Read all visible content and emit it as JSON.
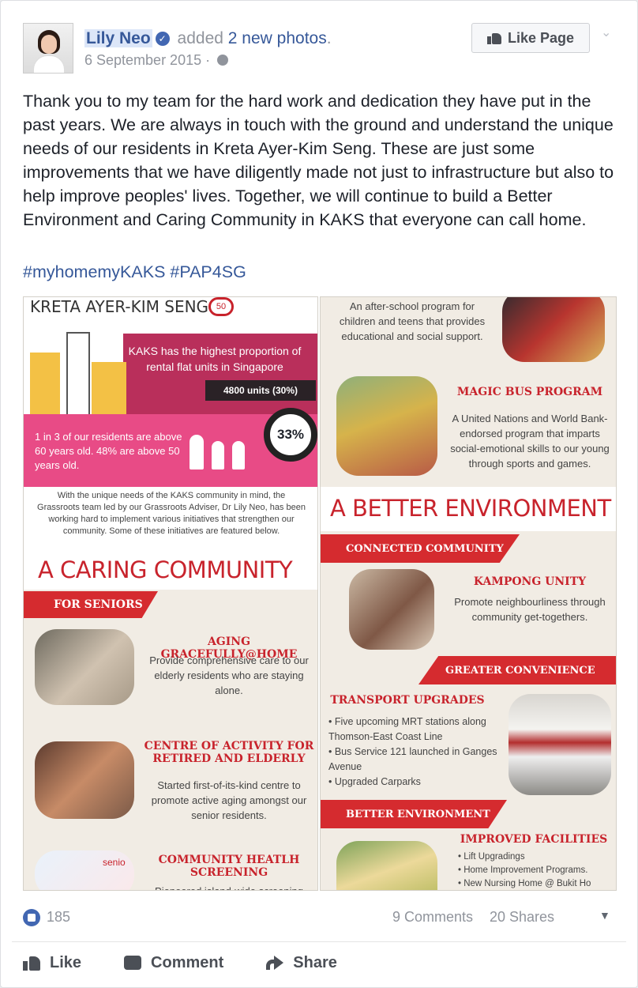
{
  "post": {
    "author": "Lily Neo",
    "action_prefix": "added",
    "action_link": "2 new photos",
    "action_suffix": ".",
    "date": "6 September 2015",
    "like_page_label": "Like Page",
    "body": "Thank you to my team for the hard work and dedication they have put in the past years. We are always in touch with the ground and understand the unique needs of our residents in Kreta Ayer-Kim Seng. These are just some improvements that we have diligently made not just to infrastructure but also to help improve peoples' lives. Together, we will continue to build a Better Environment and Caring Community in KAKS that everyone can call home.",
    "hashtags": "#myhomemyKAKS #PAP4SG"
  },
  "left_infographic": {
    "title": "KRETA AYER-KIM SENG",
    "badge": "50",
    "rental_text": "KAKS has the highest proportion of rental flat units in Singapore",
    "units": "4800 units (30%)",
    "residents_text": "1 in 3 of our residents are above 60 years old. 48% are above 50 years old.",
    "percent": "33%",
    "intro": "With the unique needs of the KAKS community in mind, the Grassroots team led by our Grassroots Adviser, Dr Lily Neo, has been working hard to implement various initiatives that strengthen our community. Some of these initiatives are featured below.",
    "heading": "A CARING COMMUNITY",
    "ribbon": "FOR SENIORS",
    "item1_title": "AGING GRACEFULLY@HOME",
    "item1_text": "Provide comprehensive care to our elderly residents who are staying alone.",
    "item2_title": "CENTRE OF ACTIVITY FOR RETIRED AND ELDERLY",
    "item2_text": "Started first-of-its-kind centre to promote active aging amongst our senior residents.",
    "item3_title": "COMMUNITY HEATLH SCREENING",
    "item3_text": "Pioneered island-wide screening",
    "item3_logo": "senio"
  },
  "right_infographic": {
    "top_text": "An after-school program for children and teens that provides educational and social support.",
    "magic_title": "MAGIC BUS PROGRAM",
    "magic_text": "A United Nations and World Bank-endorsed program that imparts social-emotional skills to our young through sports and games.",
    "heading": "A BETTER ENVIRONMENT",
    "ribbon1": "CONNECTED COMMUNITY",
    "kampong_title": "KAMPONG UNITY",
    "kampong_text": "Promote neighbourliness through community get-togethers.",
    "ribbon2": "GREATER CONVENIENCE",
    "transport_title": "TRANSPORT UPGRADES",
    "transport_bullets": [
      "Five upcoming MRT stations along Thomson-East Coast Line",
      "Bus Service 121 launched in Ganges Avenue",
      "Upgraded Carparks"
    ],
    "ribbon3": "BETTER ENVIRONMENT",
    "facilities_title": "IMPROVED FACILITIES",
    "facilities_bullets": [
      "Lift Upgradings",
      "Home Improvement Programs.",
      "New Nursing Home @ Bukit Ho"
    ]
  },
  "footer": {
    "likes": "185",
    "comments": "9 Comments",
    "shares": "20 Shares",
    "like_label": "Like",
    "comment_label": "Comment",
    "share_label": "Share"
  },
  "colors": {
    "link": "#365899",
    "accent_red": "#c8232c",
    "brand_blue": "#4267b2"
  },
  "icons": [
    "verified-icon",
    "globe-icon",
    "thumbs-up-icon",
    "chevron-down-icon",
    "like-reaction-icon",
    "comment-icon",
    "share-icon"
  ]
}
